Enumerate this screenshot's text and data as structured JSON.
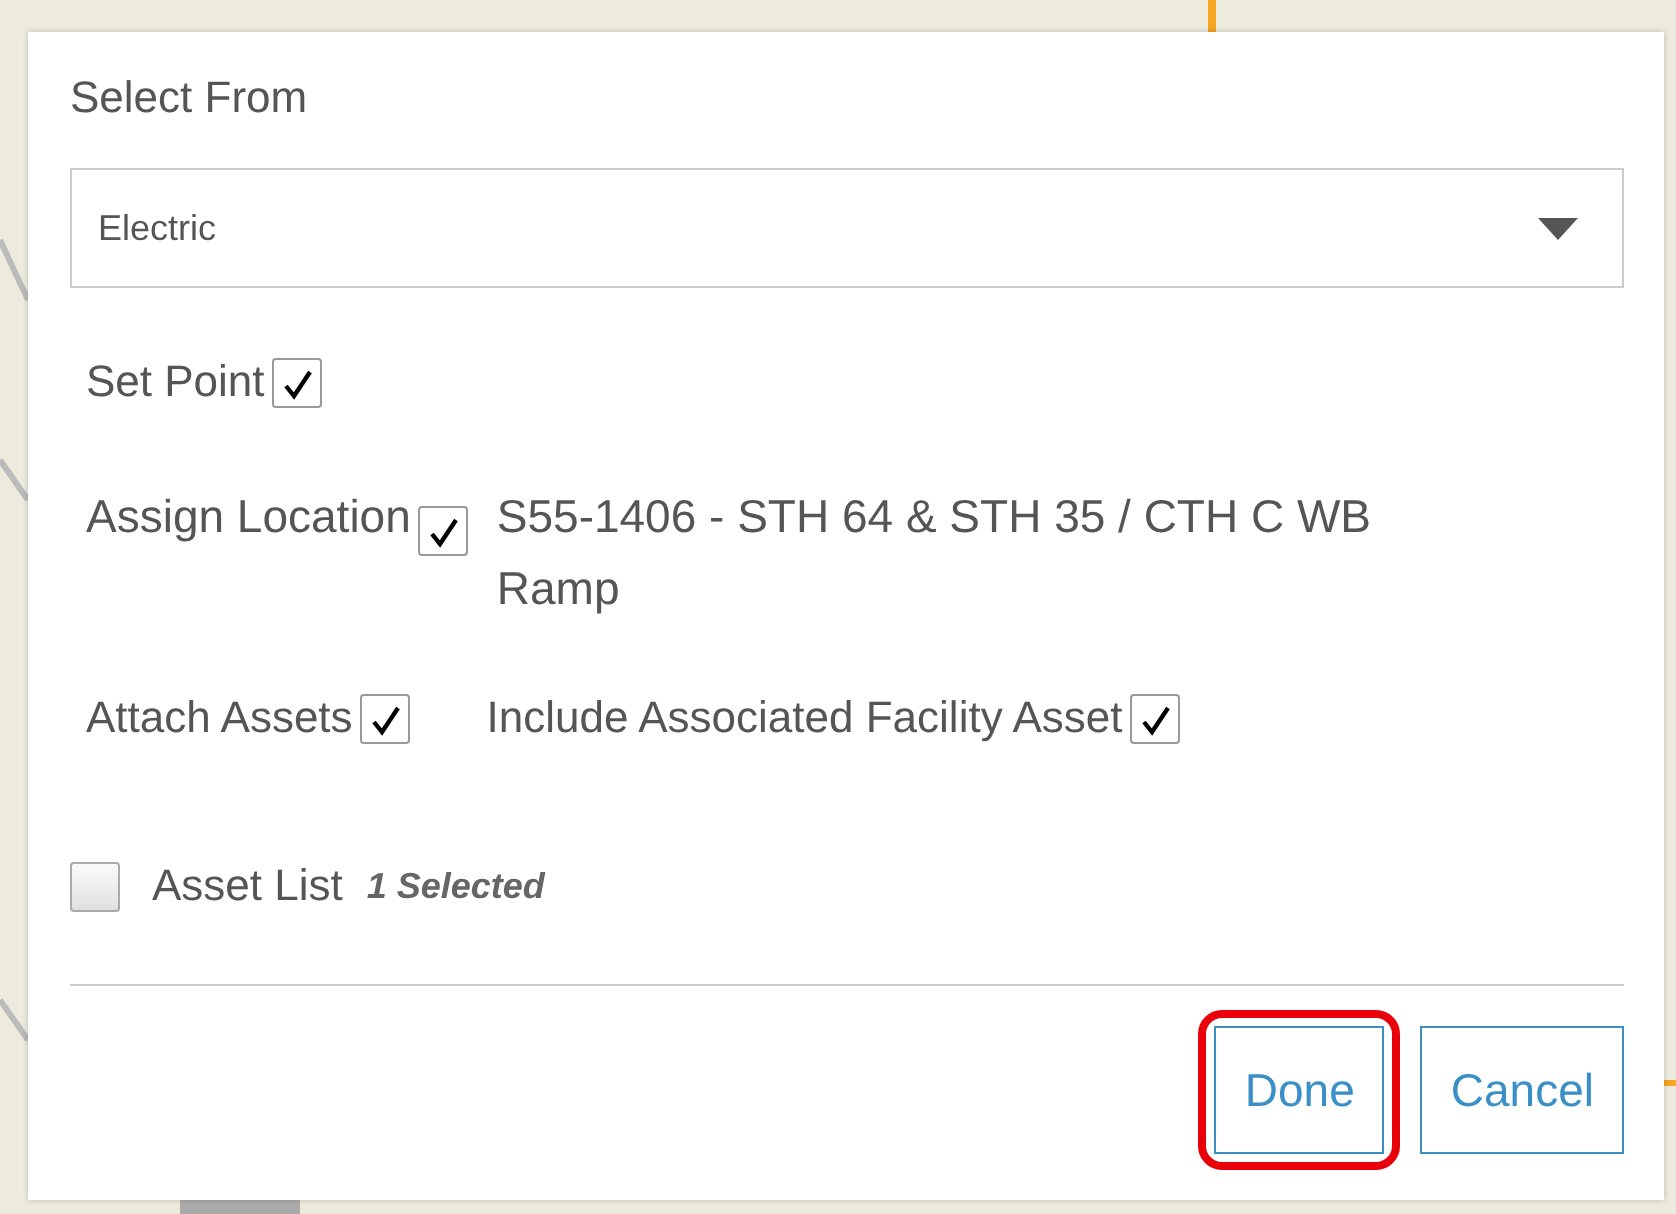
{
  "dialog": {
    "title": "Select From",
    "select": {
      "value": "Electric"
    },
    "options": [
      {
        "label": "Set Point",
        "checked": true
      },
      {
        "label": "Assign Location",
        "checked": true,
        "value": "S55-1406 - STH 64 & STH 35 / CTH C WB Ramp"
      },
      {
        "label": "Attach Assets",
        "checked": true
      },
      {
        "label": "Include Associated Facility Asset",
        "checked": true
      }
    ],
    "asset_list": {
      "label": "Asset List",
      "checked": false,
      "count": "1 Selected"
    },
    "buttons": [
      {
        "label": "Done",
        "highlighted": true
      },
      {
        "label": "Cancel",
        "highlighted": false
      }
    ]
  }
}
